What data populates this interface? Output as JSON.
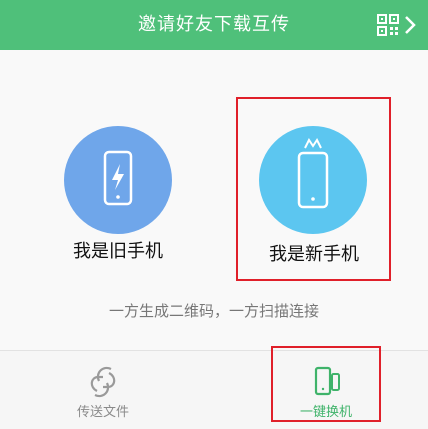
{
  "header": {
    "title": "邀请好友下载互传",
    "qr_icon": "qr-code-icon",
    "chevron_icon": "chevron-right-icon"
  },
  "main": {
    "old_phone": {
      "label": "我是旧手机",
      "icon": "phone-charging-icon",
      "color": "#6fa6ea"
    },
    "new_phone": {
      "label": "我是新手机",
      "icon": "new-phone-crown-icon",
      "color": "#5cc6f0"
    },
    "hint": "一方生成二维码，一方扫描连接"
  },
  "tabs": [
    {
      "label": "传送文件",
      "icon": "link-icon",
      "active": false
    },
    {
      "label": "一键换机",
      "icon": "switch-phone-icon",
      "active": true
    }
  ],
  "colors": {
    "accent": "#4fc07a",
    "highlight": "#e0202a"
  }
}
